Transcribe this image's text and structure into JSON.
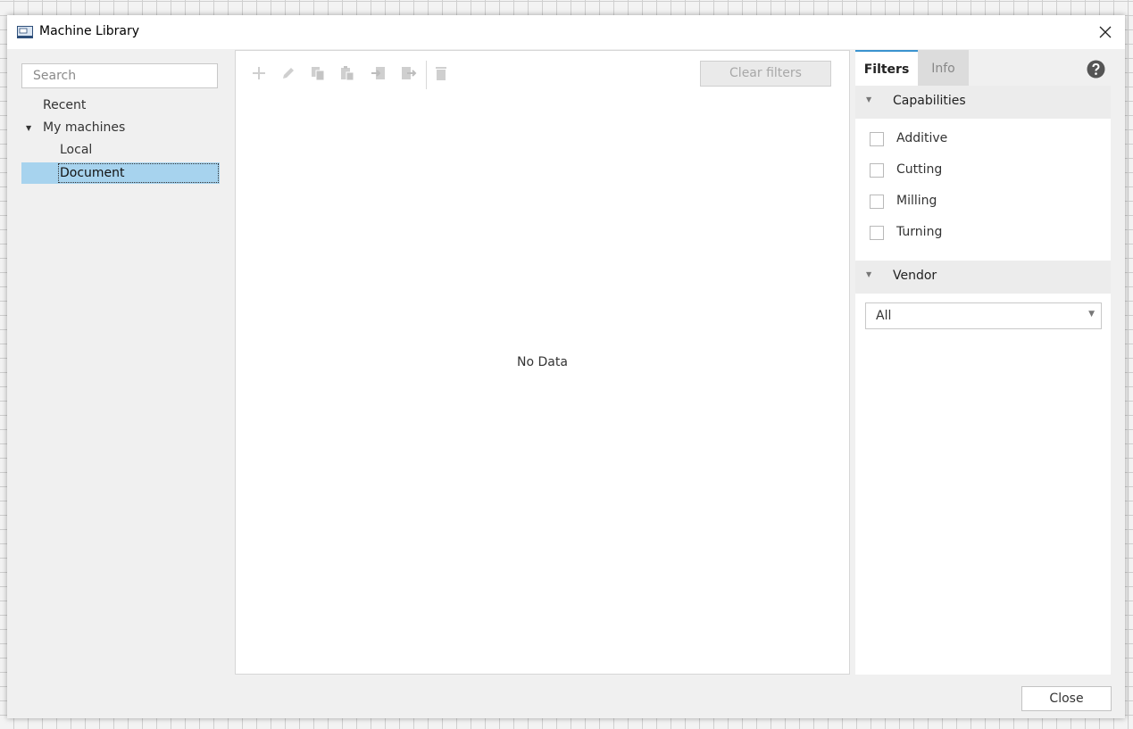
{
  "window": {
    "title": "Machine Library",
    "icon": "machine-library-icon"
  },
  "sidebar": {
    "search_placeholder": "Search",
    "items": [
      {
        "label": "Recent"
      },
      {
        "label": "My machines",
        "expanded": true
      },
      {
        "label": "Local"
      },
      {
        "label": "Document",
        "selected": true
      }
    ]
  },
  "toolbar": {
    "icons": [
      "add-icon",
      "edit-icon",
      "copy-icon",
      "paste-icon",
      "import-icon",
      "export-icon",
      "delete-icon"
    ],
    "clear_filters_label": "Clear filters"
  },
  "main": {
    "empty_text": "No Data"
  },
  "filters_panel": {
    "tabs": [
      {
        "label": "Filters",
        "active": true
      },
      {
        "label": "Info",
        "active": false
      }
    ],
    "capabilities": {
      "header": "Capabilities",
      "options": [
        {
          "label": "Additive",
          "checked": false
        },
        {
          "label": "Cutting",
          "checked": false
        },
        {
          "label": "Milling",
          "checked": false
        },
        {
          "label": "Turning",
          "checked": false
        }
      ]
    },
    "vendor": {
      "header": "Vendor",
      "selected": "All"
    }
  },
  "footer": {
    "close_label": "Close"
  },
  "colors": {
    "selection": "#a7d3ee",
    "active_tab_accent": "#3a93cf",
    "disabled_icon": "#cfcfcf"
  }
}
